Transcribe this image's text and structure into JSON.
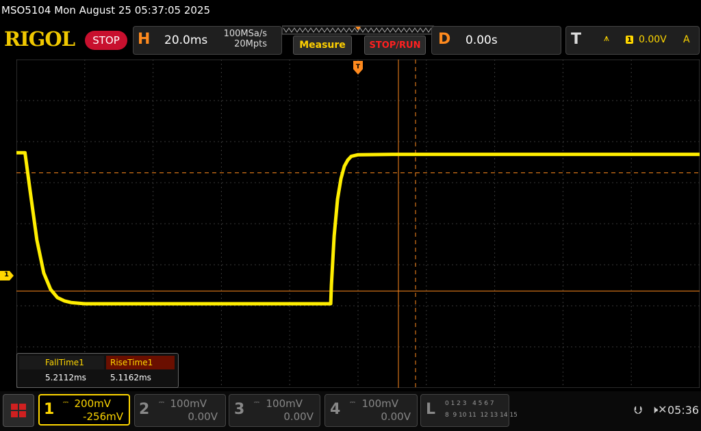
{
  "header": {
    "title": "MSO5104  Mon August 25 05:37:05 2025",
    "logo": "RIGOL",
    "status_button": "STOP"
  },
  "horizontal": {
    "letter": "H",
    "scale": "20.0ms",
    "sample_rate": "100MSa/s",
    "memory_depth": "20Mpts"
  },
  "toolbar": {
    "measure_label": "Measure",
    "stoprun_label": "STOP/RUN"
  },
  "delay": {
    "letter": "D",
    "value": "0.00s"
  },
  "trigger": {
    "letter": "T",
    "edge_icon": "rising-edge-icon",
    "source": "1",
    "level": "0.00V",
    "mode": "A"
  },
  "screen": {
    "ch1_marker": "1",
    "waveform": {
      "color": "#ffee00",
      "x_ms": [
        -100,
        -97.5,
        -96,
        -94,
        -92,
        -90,
        -88,
        -86,
        -84,
        -80,
        -70,
        -10,
        -8,
        -7.8,
        -7,
        -6,
        -5,
        -4,
        -3,
        -2,
        0,
        10,
        100
      ],
      "y_div": [
        1.73,
        1.73,
        0.8,
        -0.4,
        -1.2,
        -1.6,
        -1.8,
        -1.88,
        -1.92,
        -1.95,
        -1.95,
        -1.95,
        -1.95,
        -1.5,
        -0.3,
        0.6,
        1.1,
        1.4,
        1.55,
        1.64,
        1.68,
        1.69,
        1.69
      ]
    },
    "cursor_level_div": 1.24,
    "ref_level_div": -1.64
  },
  "measurements": {
    "fall_label": "FallTime1",
    "rise_label": "RiseTime1",
    "fall_value": "5.2112ms",
    "rise_value": "5.1162ms"
  },
  "channels": [
    {
      "num": "1",
      "scale": "200mV",
      "offset": "-256mV",
      "active": true,
      "color": "#ffd700"
    },
    {
      "num": "2",
      "scale": "100mV",
      "offset": "0.00V",
      "active": false,
      "color": "#888888"
    },
    {
      "num": "3",
      "scale": "100mV",
      "offset": "0.00V",
      "active": false,
      "color": "#888888"
    },
    {
      "num": "4",
      "scale": "100mV",
      "offset": "0.00V",
      "active": false,
      "color": "#888888"
    }
  ],
  "logic": {
    "letter": "L",
    "row1": "0 1 2 3   4 5 6 7",
    "row2": "8  9 10 11  12 13 14 15"
  },
  "status": {
    "usb_icon": "usb-icon",
    "speaker_icon": "speaker-muted-icon",
    "time": "05:36"
  }
}
